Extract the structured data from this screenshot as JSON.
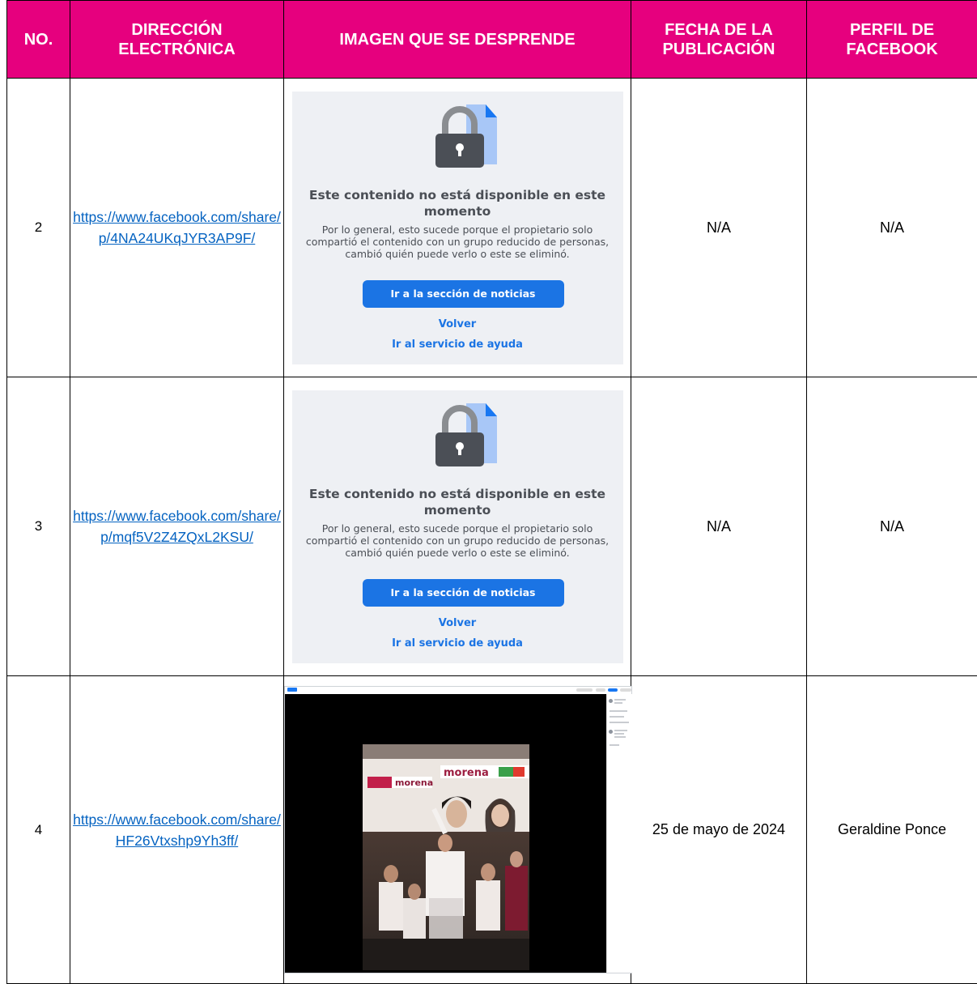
{
  "table": {
    "headers": {
      "no": "NO.",
      "address": "DIRECCIÓN ELECTRÓNICA",
      "image": "IMAGEN QUE SE DESPRENDE",
      "date": "FECHA DE LA PUBLICACIÓN",
      "profile": "PERFIL DE FACEBOOK"
    },
    "rows": [
      {
        "no": "2",
        "url": "https://www.facebook.com/share/p/4NA24UKqJYR3AP9F/",
        "date": "N/A",
        "profile": "N/A",
        "panel": {
          "title": "Este contenido no está disponible en este momento",
          "description": "Por lo general, esto sucede porque el propietario solo compartió el contenido con un grupo reducido de personas, cambió quién puede verlo o este se eliminó.",
          "button": "Ir a la sección de noticias",
          "back": "Volver",
          "help": "Ir al servicio de ayuda"
        }
      },
      {
        "no": "3",
        "url": "https://www.facebook.com/share/p/mqf5V2Z4ZQxL2KSU/",
        "date": "N/A",
        "profile": "N/A",
        "panel": {
          "title": "Este contenido no está disponible en este momento",
          "description": "Por lo general, esto sucede porque el propietario solo compartió el contenido con un grupo reducido de personas, cambió quién puede verlo o este se eliminó.",
          "button": "Ir a la sección de noticias",
          "back": "Volver",
          "help": "Ir al servicio de ayuda"
        }
      },
      {
        "no": "4",
        "url": "https://www.facebook.com/share/HF26Vtxshp9Yh3ff/",
        "date": "25 de mayo de 2024",
        "profile": "Geraldine Ponce",
        "screenshot": {
          "banner_text": "morena"
        }
      }
    ]
  },
  "colors": {
    "header_bg": "#E6007E",
    "header_text": "#FFFFFF",
    "link": "#0563C1",
    "fb_blue": "#1B74E4",
    "panel_bg": "#EEF0F4"
  },
  "icons": [
    "lock-icon",
    "document-icon"
  ]
}
